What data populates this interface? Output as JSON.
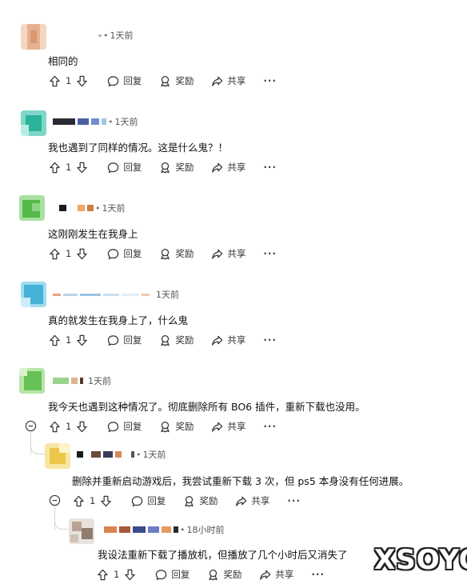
{
  "actions": {
    "reply": "回复",
    "award": "奖励",
    "share": "共享",
    "more": "···"
  },
  "comments": [
    {
      "time": "1天前",
      "text": "相同的",
      "votes": "1"
    },
    {
      "time": "1天前",
      "text": "我也遇到了同样的情况。这是什么鬼？！",
      "votes": "1"
    },
    {
      "time": "1天前",
      "text": "这刚刚发生在我身上",
      "votes": "1"
    },
    {
      "time": "1天前",
      "text": "真的就发生在我身上了，什么鬼",
      "votes": "1"
    },
    {
      "time": "1天前",
      "text": "我今天也遇到这种情况了。彻底删除所有 BO6 插件，重新下载也没用。",
      "votes": "1"
    },
    {
      "time": "1天前",
      "text": "删除并重新启动游戏后，我尝试重新下载 3 次，但 ps5 本身没有任何进展。",
      "votes": "1"
    },
    {
      "time": "18小时前",
      "text": "我设法重新下载了播放机，但播放了几个小时后又消失了",
      "votes": "1"
    }
  ],
  "watermark": "XSOYO"
}
